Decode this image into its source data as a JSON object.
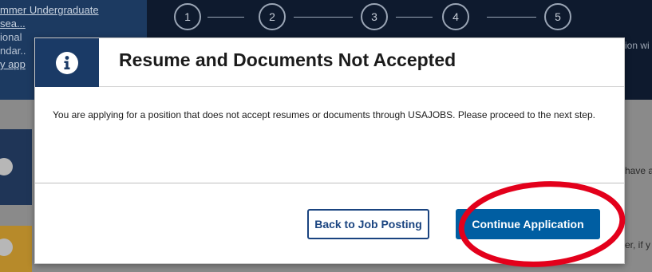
{
  "background": {
    "left_panel_lines": [
      "mmer Undergraduate",
      "sea...",
      "ional",
      "ndar..",
      "y app"
    ],
    "steps": [
      "1",
      "2",
      "3",
      "4",
      "5"
    ],
    "right_header_text": "ion wi",
    "right_text_1": "have a",
    "right_text_2": "er, if y"
  },
  "modal": {
    "icon": "info-icon",
    "title": "Resume and Documents Not Accepted",
    "body": "You are applying for a position that does not accept resumes or documents through USAJOBS. Please proceed to the next step.",
    "back_button": "Back to Job Posting",
    "continue_button": "Continue Application"
  },
  "colors": {
    "header_navy": "#1a3a66",
    "primary_blue": "#005ea2",
    "secondary_border": "#1a4480",
    "annotation_red": "#e3001b"
  }
}
